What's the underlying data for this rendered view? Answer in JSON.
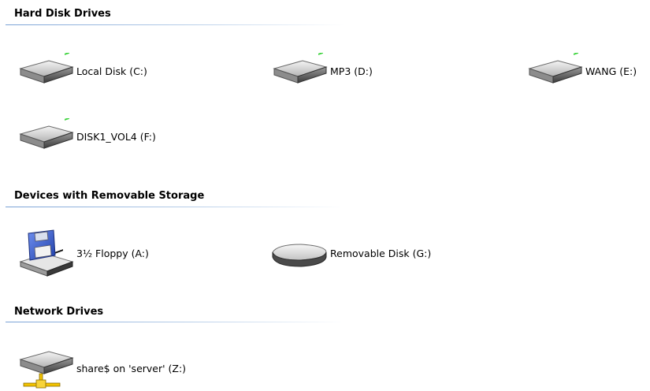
{
  "groups": {
    "hard_disk": {
      "title": "Hard Disk Drives",
      "items": [
        {
          "label": "Local Disk (C:)",
          "icon": "hard-drive-icon"
        },
        {
          "label": "MP3 (D:)",
          "icon": "hard-drive-icon"
        },
        {
          "label": "WANG (E:)",
          "icon": "hard-drive-icon"
        },
        {
          "label": "DISK1_VOL4 (F:)",
          "icon": "hard-drive-icon"
        }
      ]
    },
    "removable": {
      "title": "Devices with Removable Storage",
      "items": [
        {
          "label": "3½ Floppy (A:)",
          "icon": "floppy-drive-icon"
        },
        {
          "label": "Removable Disk (G:)",
          "icon": "removable-disk-icon"
        }
      ]
    },
    "network": {
      "title": "Network Drives",
      "items": [
        {
          "label": "share$ on 'server' (Z:)",
          "icon": "network-drive-icon"
        }
      ]
    }
  },
  "colors": {
    "header_rule": "#7aa2d6",
    "drive_body": "#c8c8c8",
    "drive_dark": "#4a4a4a",
    "floppy_blue": "#2f55c8",
    "network_yellow": "#f2c200",
    "led_green": "#3ed43e"
  }
}
